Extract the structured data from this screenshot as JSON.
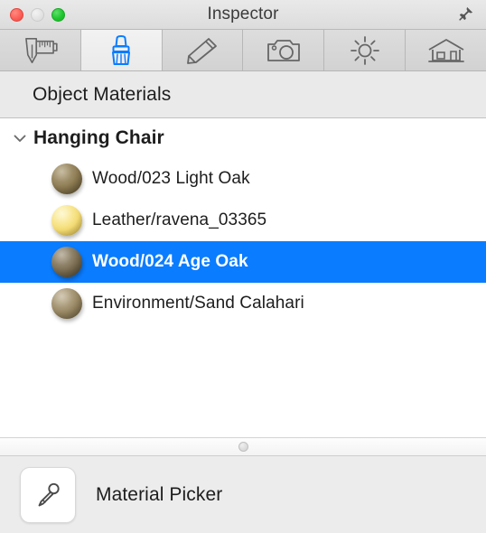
{
  "window": {
    "title": "Inspector",
    "traffic_lights": [
      {
        "name": "close",
        "color": "#fc6058"
      },
      {
        "name": "minimize",
        "color": "#e2e2e2"
      },
      {
        "name": "zoom",
        "color": "#1ec62e"
      }
    ],
    "pin_icon": "pushpin-icon"
  },
  "tabs": [
    {
      "id": "measure",
      "icon": "caliper-icon",
      "label": "Measure",
      "active": false
    },
    {
      "id": "materials",
      "icon": "paintbrush-icon",
      "label": "Materials",
      "active": true
    },
    {
      "id": "edit",
      "icon": "pencil-icon",
      "label": "Edit",
      "active": false
    },
    {
      "id": "camera",
      "icon": "camera-icon",
      "label": "Camera",
      "active": false
    },
    {
      "id": "light",
      "icon": "sun-icon",
      "label": "Light",
      "active": false
    },
    {
      "id": "scene",
      "icon": "house-icon",
      "label": "Scene",
      "active": false
    }
  ],
  "section": {
    "title": "Object Materials"
  },
  "group": {
    "label": "Hanging Chair",
    "expanded": true,
    "disclosure_icon": "chevron-down-icon"
  },
  "materials": [
    {
      "label": "Wood/023 Light Oak",
      "swatch_color": "#8d7b52",
      "swatch_color_dark": "#5d5030",
      "selected": false
    },
    {
      "label": "Leather/ravena_03365",
      "swatch_color": "#f6e07c",
      "swatch_color_dark": "#d8b747",
      "selected": false
    },
    {
      "label": "Wood/024 Age Oak",
      "swatch_color": "#7d6f54",
      "swatch_color_dark": "#4e452f",
      "selected": true
    },
    {
      "label": "Environment/Sand Calahari",
      "swatch_color": "#9b8a66",
      "swatch_color_dark": "#6b5d3e",
      "selected": false
    }
  ],
  "splitter": {
    "grip_icon": "resize-grip-icon"
  },
  "footer": {
    "picker_icon": "eyedropper-icon",
    "picker_label": "Material Picker"
  },
  "colors": {
    "selection_blue": "#0a7cff",
    "accent_blue": "#0a7cff",
    "chrome_gray": "#d6d6d6",
    "header_gray": "#eaeaea",
    "footer_gray": "#ececec"
  }
}
